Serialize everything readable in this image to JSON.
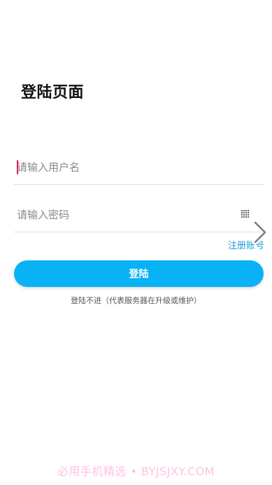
{
  "page": {
    "title": "登陆页面"
  },
  "form": {
    "username_placeholder": "请输入用户名",
    "password_placeholder": "请输入密码",
    "username_value": "",
    "password_value": ""
  },
  "links": {
    "register": "注册账号"
  },
  "buttons": {
    "login": "登陆"
  },
  "hint": "登陆不进（代表服务器在升级或维护）",
  "watermark": "必用手机精选 • BYJSJXY.COM",
  "icons": {
    "password_field": "keypad-icon",
    "side": "chevron-right-icon"
  },
  "colors": {
    "accent": "#08b2f5",
    "link": "#1a9be0",
    "caret": "#d81b60",
    "watermark": "#ffc2e2"
  }
}
